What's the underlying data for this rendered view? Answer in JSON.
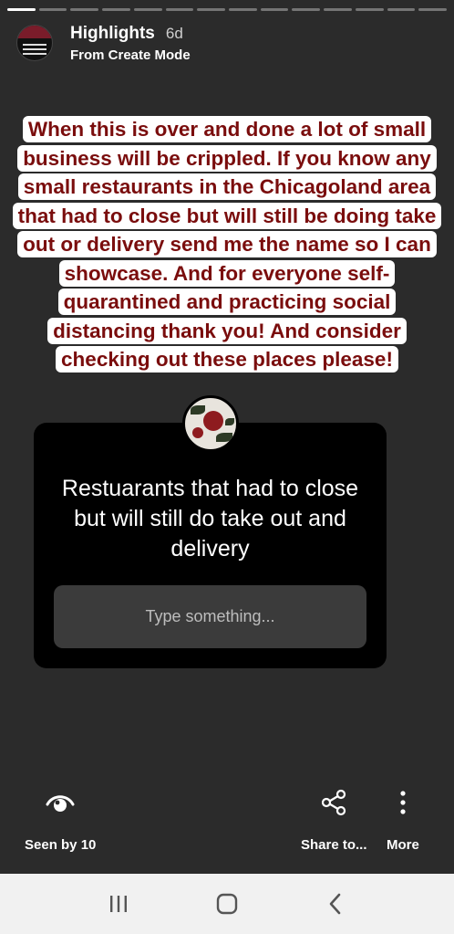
{
  "progress": {
    "total": 14,
    "done": 1
  },
  "header": {
    "title": "Highlights",
    "age": "6d",
    "subtitle": "From Create Mode"
  },
  "caption": "When this is over and done a lot of small business will be crippled. If you know any small restaurants in the Chicagoland area that had to close but will still be doing take out  or delivery send me the name so I can showcase. And for everyone self-quarantined and practicing social distancing thank you! And consider checking out these places please!",
  "question": {
    "title": "Restuarants that had to close but will still do take out and delivery",
    "input_placeholder": "Type something..."
  },
  "actions": {
    "seen": "Seen by 10",
    "share": "Share to...",
    "more": "More"
  },
  "colors": {
    "background": "#2b2b2b",
    "caption_text": "#7a0d0d",
    "caption_bg": "#ffffff",
    "card": "#000000",
    "input": "#3b3b3b"
  },
  "icons": {
    "seen": "eye-icon",
    "share": "share-icon",
    "more": "more-vertical-icon",
    "recents": "recents-icon",
    "home": "home-icon",
    "back": "back-icon"
  }
}
